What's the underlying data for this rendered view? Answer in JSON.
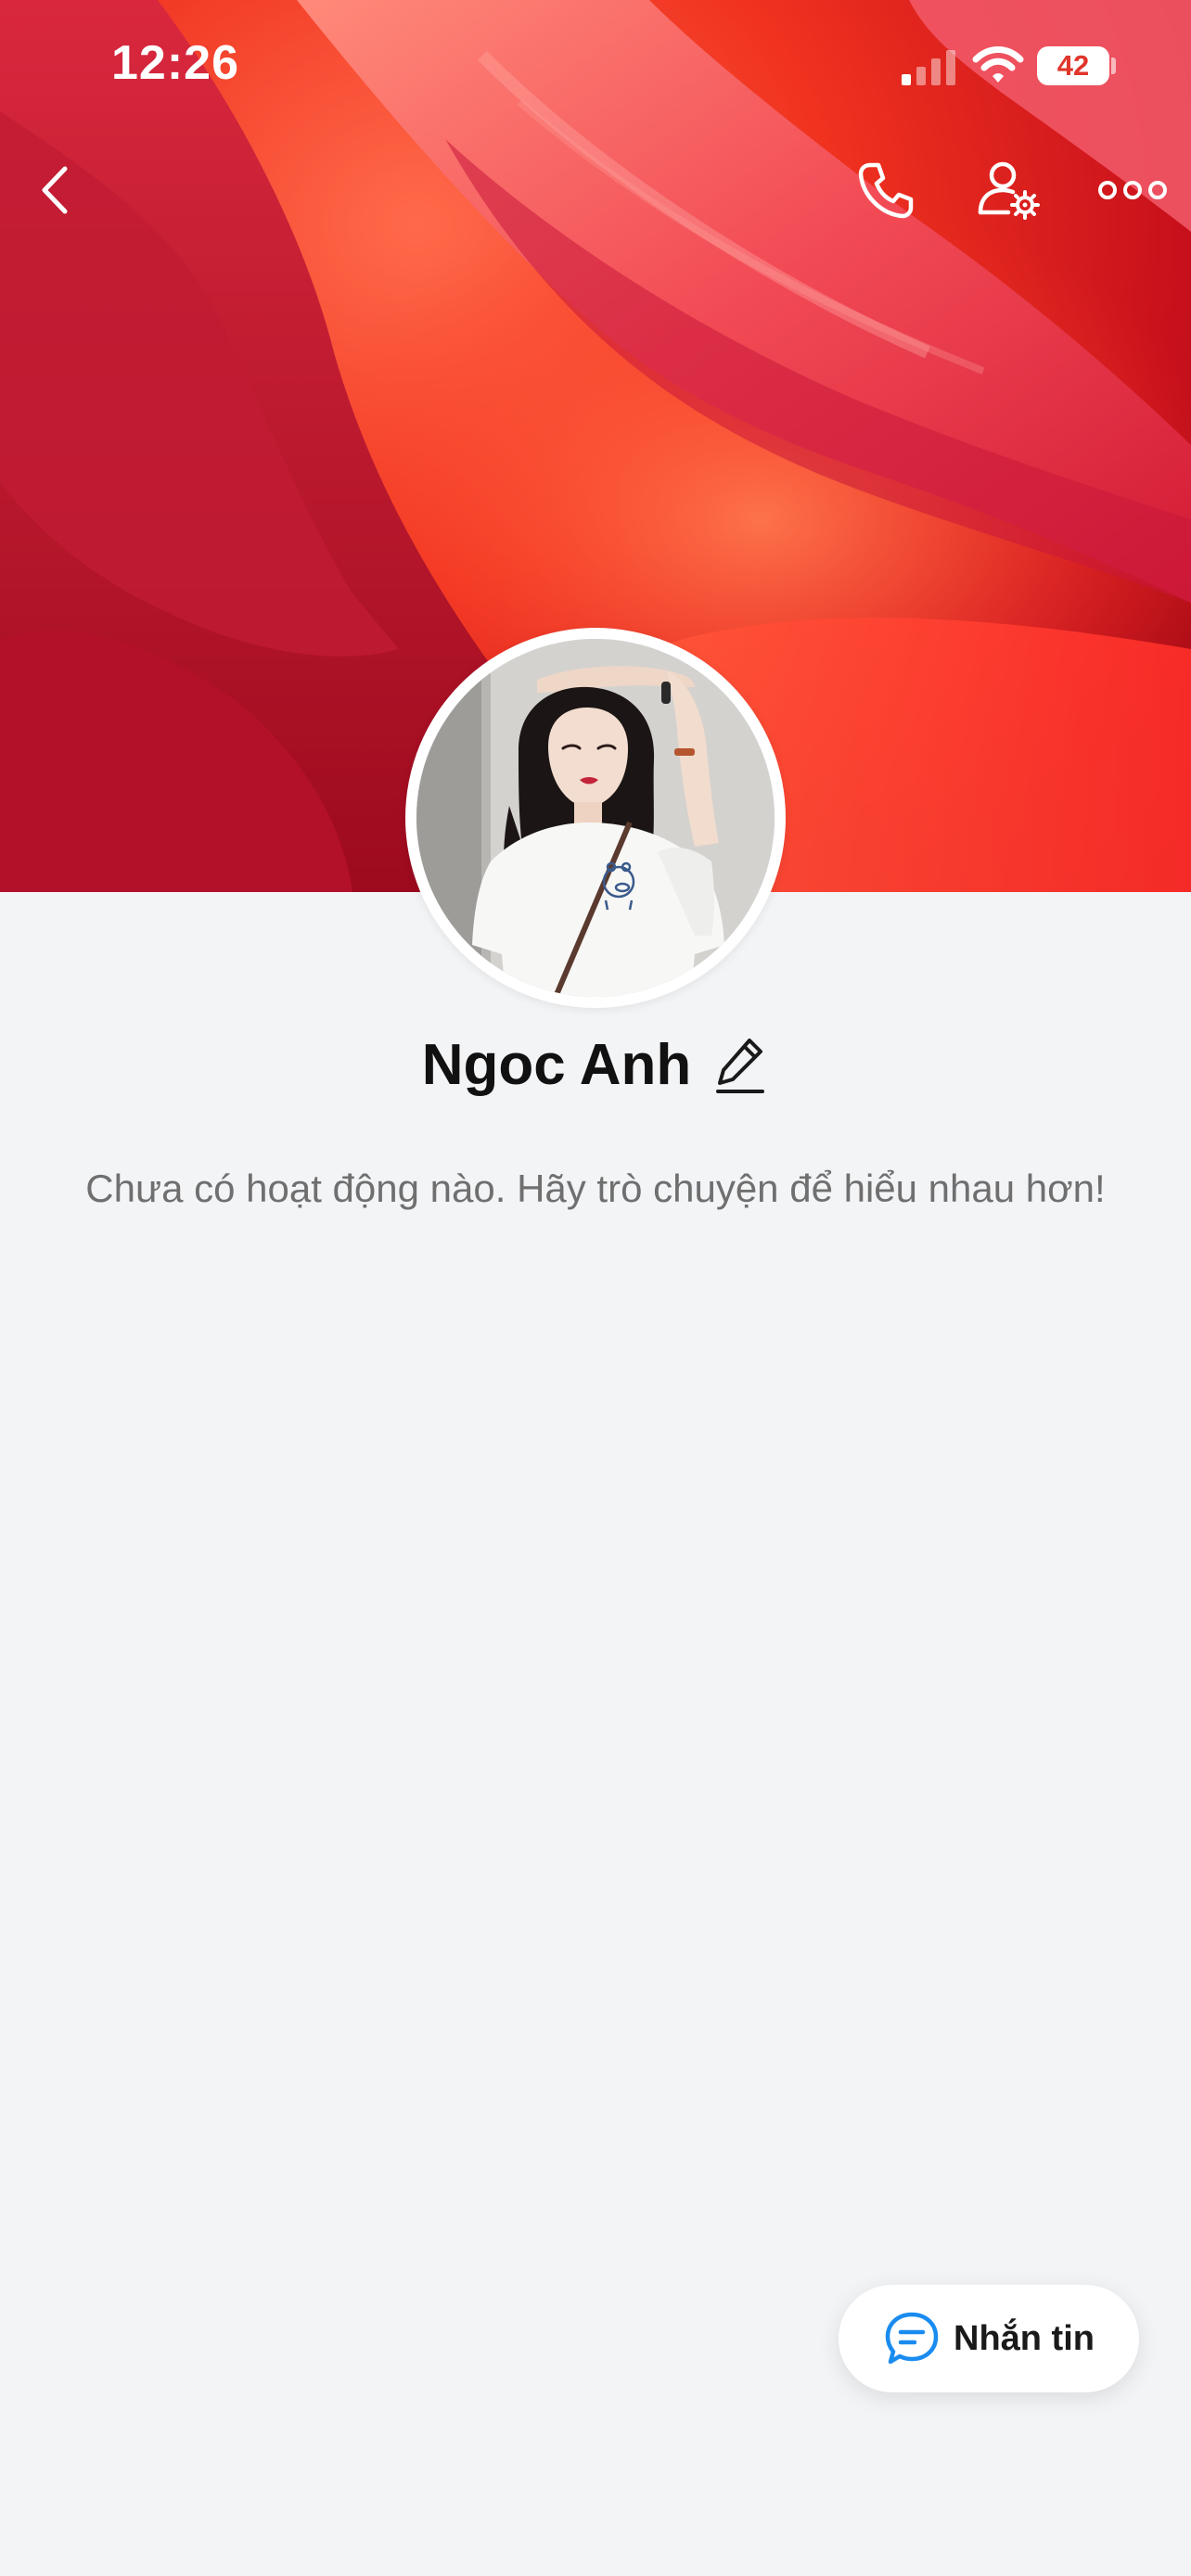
{
  "status_bar": {
    "time": "12:26",
    "battery_level": "42"
  },
  "header": {
    "back_icon": "chevron-left-icon",
    "call_icon": "phone-icon",
    "settings_icon": "user-settings-icon",
    "more_icon": "more-horizontal-icon"
  },
  "profile": {
    "name": "Ngoc Anh",
    "edit_icon": "pencil-icon",
    "empty_message": "Chưa có hoạt động nào. Hãy trò chuyện để hiểu nhau hơn!"
  },
  "fab": {
    "label": "Nhắn tin",
    "icon": "chat-bubble-icon"
  },
  "colors": {
    "background": "#f3f4f6",
    "accent": "#1a8cf0",
    "cover": "#e8321f"
  }
}
